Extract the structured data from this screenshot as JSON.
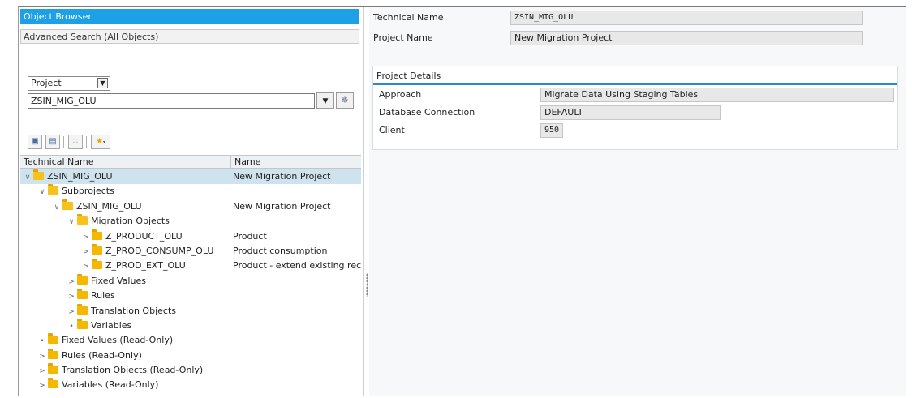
{
  "nav": {
    "object_browser": "Object Browser",
    "advanced_search": "Advanced Search (All Objects)"
  },
  "filter": {
    "type_value": "Project",
    "project_value": "ZSIN_MIG_OLU"
  },
  "tree": {
    "col_technical_name": "Technical Name",
    "col_name": "Name",
    "rows": [
      {
        "label": "ZSIN_MIG_OLU",
        "name": "New Migration Project"
      },
      {
        "label": "Subprojects",
        "name": ""
      },
      {
        "label": "ZSIN_MIG_OLU",
        "name": "New Migration Project"
      },
      {
        "label": "Migration Objects",
        "name": ""
      },
      {
        "label": "Z_PRODUCT_OLU",
        "name": "Product"
      },
      {
        "label": "Z_PROD_CONSUMP_OLU",
        "name": "Product consumption"
      },
      {
        "label": "Z_PROD_EXT_OLU",
        "name": "Product - extend existing rec"
      },
      {
        "label": "Fixed Values",
        "name": ""
      },
      {
        "label": "Rules",
        "name": ""
      },
      {
        "label": "Translation Objects",
        "name": ""
      },
      {
        "label": "Variables",
        "name": ""
      },
      {
        "label": "Fixed Values (Read-Only)",
        "name": ""
      },
      {
        "label": "Rules (Read-Only)",
        "name": ""
      },
      {
        "label": "Translation Objects (Read-Only)",
        "name": ""
      },
      {
        "label": "Variables (Read-Only)",
        "name": ""
      }
    ]
  },
  "header": {
    "technical_name_label": "Technical Name",
    "technical_name_value": "ZSIN_MIG_OLU",
    "project_name_label": "Project Name",
    "project_name_value": "New Migration Project"
  },
  "details": {
    "title": "Project Details",
    "approach_label": "Approach",
    "approach_value": "Migrate Data Using Staging Tables",
    "db_label": "Database Connection",
    "db_value": "DEFAULT",
    "client_label": "Client",
    "client_value": "950"
  },
  "colors": {
    "accent": "#1ea0e6",
    "folder": "#f5b800",
    "selected_row": "#cfe3ef"
  }
}
